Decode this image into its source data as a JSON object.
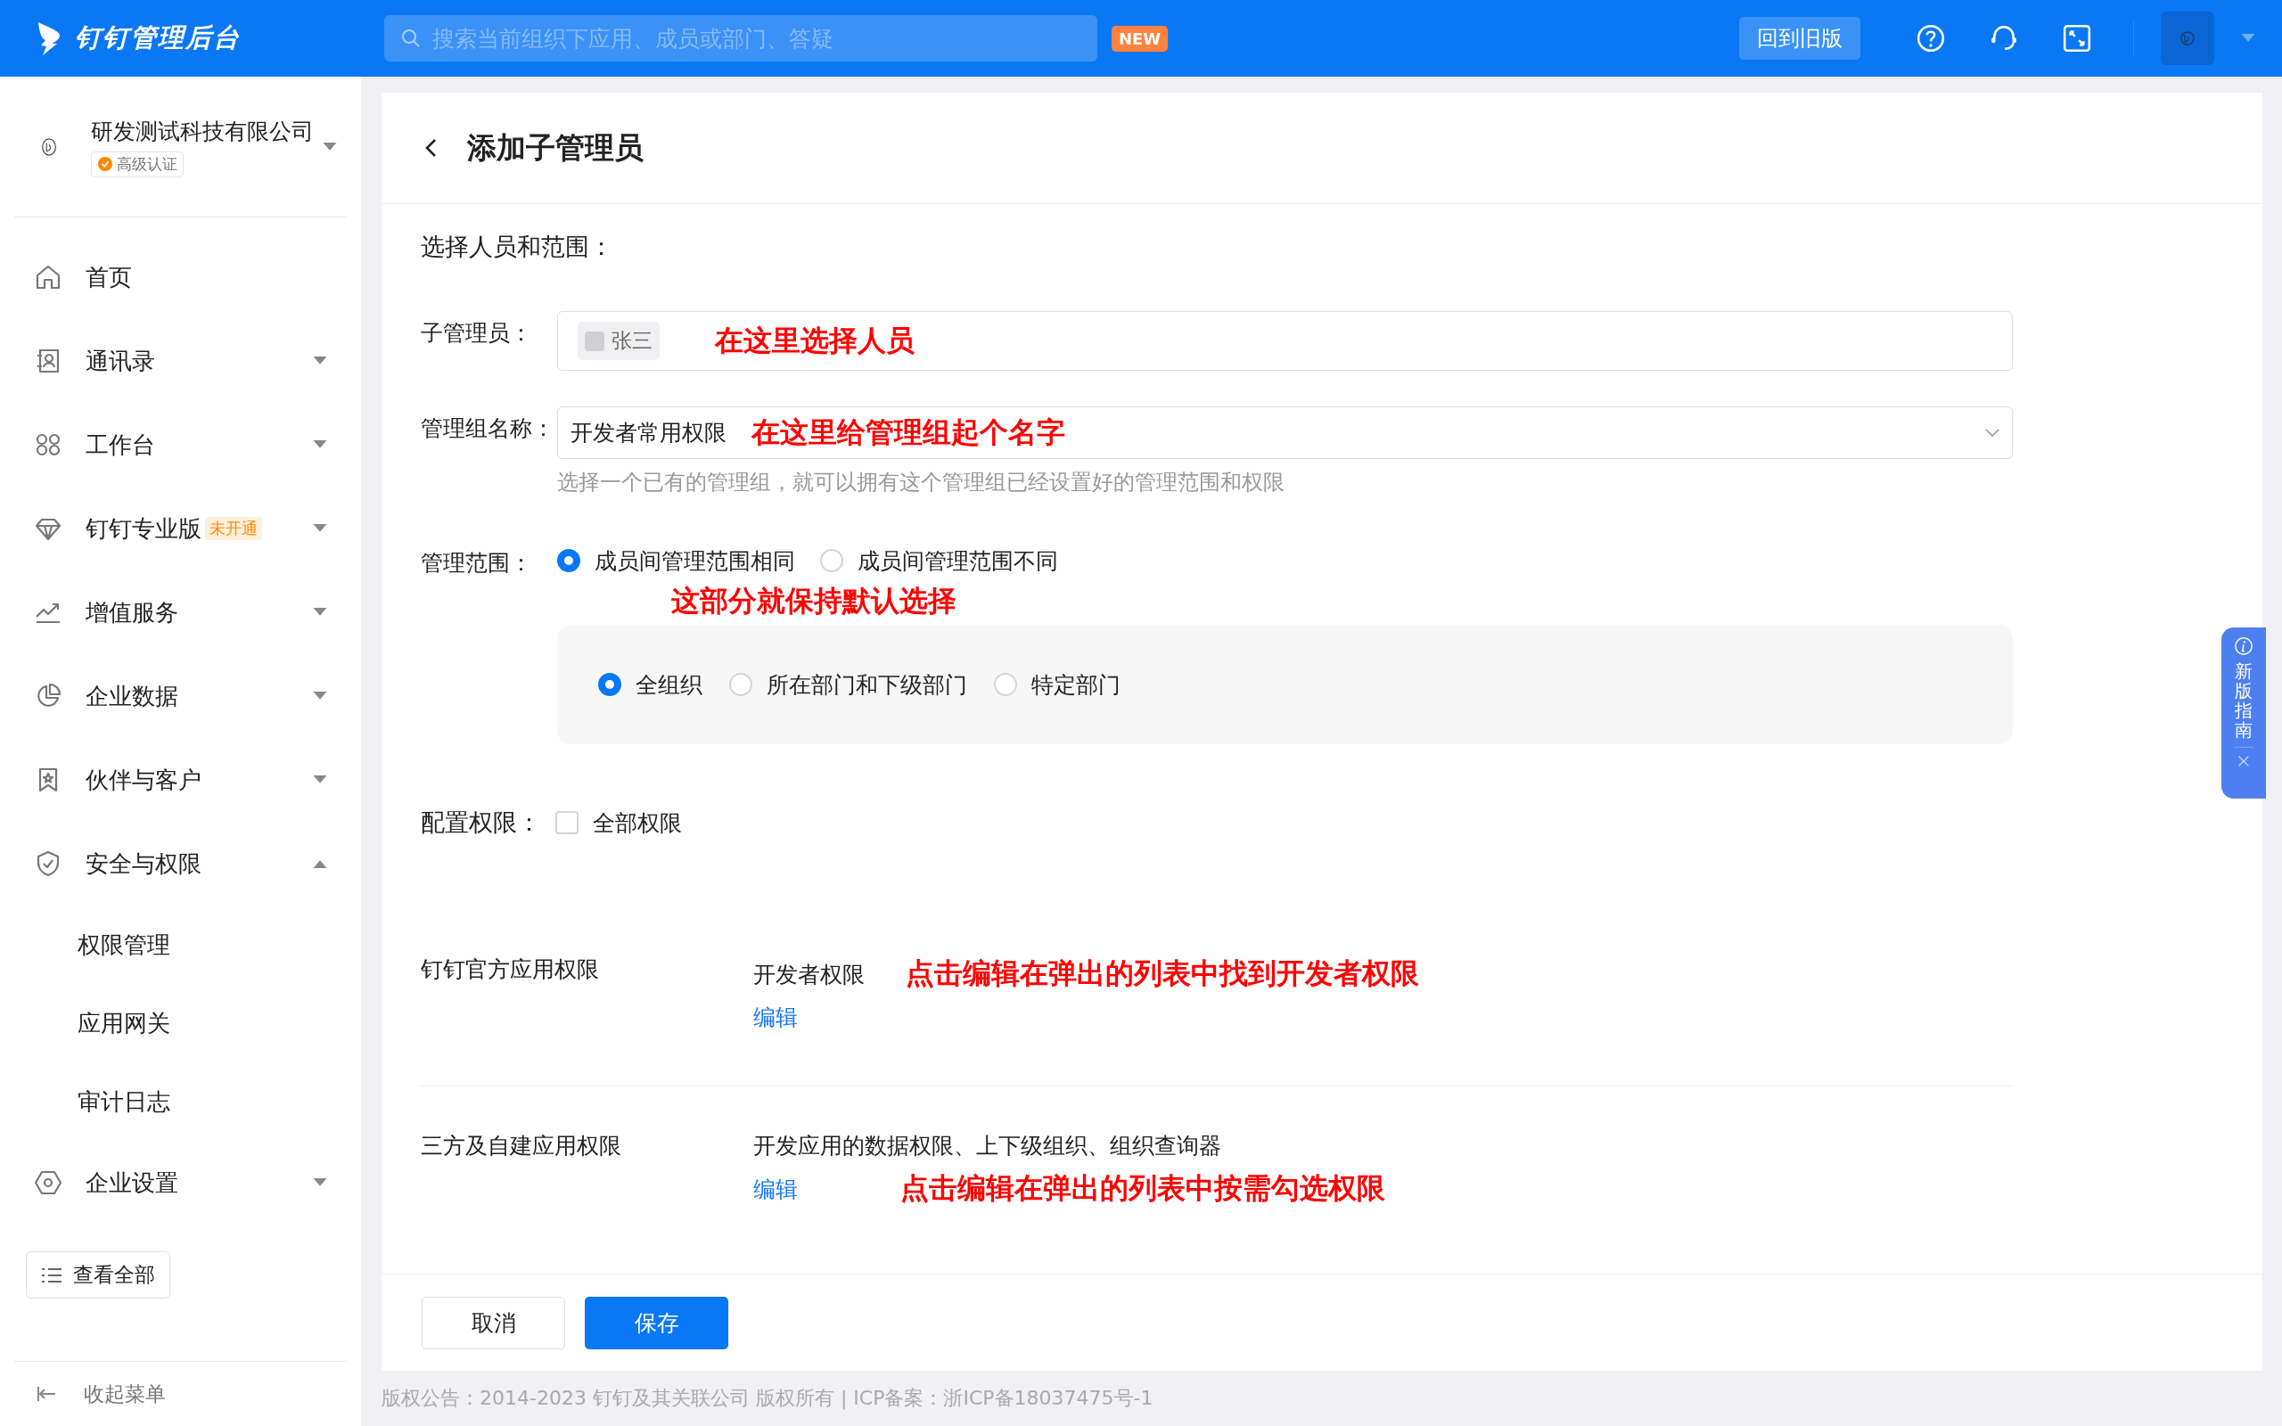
{
  "topbar": {
    "title": "钉钉管理后台",
    "search": {
      "placeholder": "搜索当前组织下应用、成员或部门、答疑"
    },
    "new_badge": "NEW",
    "old_version_button": "回到旧版"
  },
  "sidebar": {
    "org": {
      "name": "研发测试科技有限公司",
      "badge": "高级认证"
    },
    "items": [
      {
        "kind": "link",
        "label": "首页"
      },
      {
        "kind": "group",
        "label": "通讯录",
        "expanded": false
      },
      {
        "kind": "group",
        "label": "工作台",
        "expanded": false
      },
      {
        "kind": "group",
        "label": "钉钉专业版",
        "tag": "未开通",
        "expanded": false
      },
      {
        "kind": "group",
        "label": "增值服务",
        "expanded": false
      },
      {
        "kind": "group",
        "label": "企业数据",
        "expanded": false
      },
      {
        "kind": "group",
        "label": "伙伴与客户",
        "expanded": false
      },
      {
        "kind": "group",
        "label": "安全与权限",
        "expanded": true,
        "children": [
          {
            "label": "权限管理"
          },
          {
            "label": "应用网关"
          },
          {
            "label": "审计日志"
          }
        ]
      },
      {
        "kind": "group",
        "label": "企业设置",
        "expanded": false
      }
    ],
    "view_all": "查看全部",
    "collapse": "收起菜单"
  },
  "page": {
    "title": "添加子管理员",
    "section_title": "选择人员和范围：",
    "admin": {
      "label": "子管理员：",
      "chip": "张三",
      "note": "在这里选择人员"
    },
    "group_name": {
      "label": "管理组名称：",
      "value": "开发者常用权限",
      "note": "在这里给管理组起个名字",
      "hint": "选择一个已有的管理组，就可以拥有这个管理组已经设置好的管理范围和权限"
    },
    "scope": {
      "label": "管理范围：",
      "options": [
        {
          "label": "成员间管理范围相同",
          "selected": true
        },
        {
          "label": "成员间管理范围不同",
          "selected": false
        }
      ],
      "note": "这部分就保持默认选择",
      "sub_options": [
        {
          "label": "全组织",
          "selected": true
        },
        {
          "label": "所在部门和下级部门",
          "selected": false
        },
        {
          "label": "特定部门",
          "selected": false
        }
      ]
    },
    "permissions": {
      "label": "配置权限：",
      "all": {
        "label": "全部权限",
        "checked": false
      },
      "rows": [
        {
          "name": "钉钉官方应用权限",
          "value": "开发者权限",
          "edit": "编辑",
          "note": "点击编辑在弹出的列表中找到开发者权限"
        },
        {
          "name": "三方及自建应用权限",
          "value": "开发应用的数据权限、上下级组织、组织查询器",
          "edit": "编辑",
          "note": "点击编辑在弹出的列表中按需勾选权限"
        }
      ]
    },
    "buttons": {
      "cancel": "取消",
      "save": "保存"
    }
  },
  "footer": "版权公告：2014-2023 钉钉及其关联公司 版权所有 | ICP备案：浙ICP备18037475号-1",
  "guide": {
    "text": "新版指南"
  }
}
